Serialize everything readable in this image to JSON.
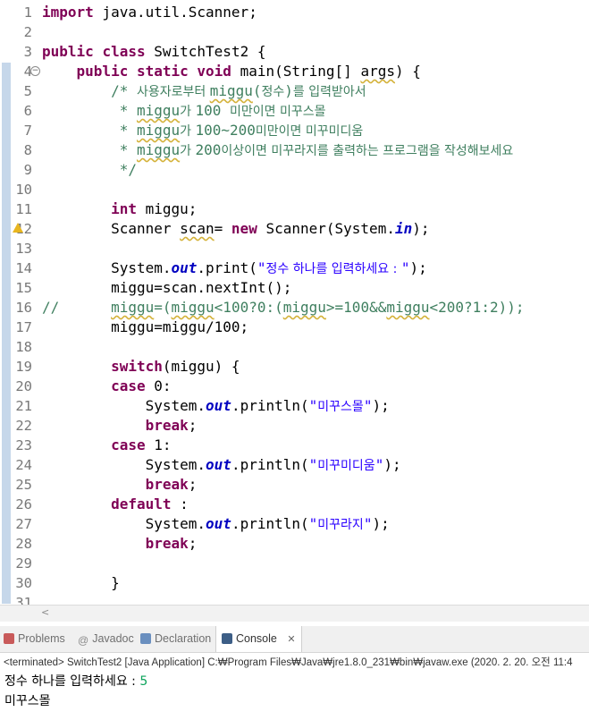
{
  "editor": {
    "lines": [
      {
        "n": "1",
        "parts": [
          {
            "t": "import",
            "c": "kw"
          },
          {
            "t": " java.util.Scanner;"
          }
        ]
      },
      {
        "n": "2",
        "parts": []
      },
      {
        "n": "3",
        "parts": [
          {
            "t": "public",
            "c": "kw"
          },
          {
            "t": " "
          },
          {
            "t": "class",
            "c": "kw"
          },
          {
            "t": " SwitchTest2 {"
          }
        ]
      },
      {
        "n": "4",
        "fold": true,
        "parts": [
          {
            "t": "    "
          },
          {
            "t": "public",
            "c": "kw"
          },
          {
            "t": " "
          },
          {
            "t": "static",
            "c": "kw"
          },
          {
            "t": " "
          },
          {
            "t": "void",
            "c": "kw"
          },
          {
            "t": " main(String[] "
          },
          {
            "t": "args",
            "c": "warn"
          },
          {
            "t": ") {"
          }
        ]
      },
      {
        "n": "5",
        "parts": [
          {
            "t": "        "
          },
          {
            "t": "/* ",
            "c": "cmt"
          },
          {
            "t": "사용자로부터 ",
            "c": "cmt kor"
          },
          {
            "t": "miggu",
            "c": "cmt warn"
          },
          {
            "t": "(",
            "c": "cmt"
          },
          {
            "t": "정수",
            "c": "cmt kor"
          },
          {
            "t": ")",
            "c": "cmt"
          },
          {
            "t": "를 입력받아서",
            "c": "cmt kor"
          }
        ]
      },
      {
        "n": "6",
        "parts": [
          {
            "t": "         * ",
            "c": "cmt"
          },
          {
            "t": "miggu",
            "c": "cmt warn"
          },
          {
            "t": "가 ",
            "c": "cmt kor"
          },
          {
            "t": "100 ",
            "c": "cmt"
          },
          {
            "t": "미만이면 미꾸스몰",
            "c": "cmt kor"
          }
        ]
      },
      {
        "n": "7",
        "parts": [
          {
            "t": "         * ",
            "c": "cmt"
          },
          {
            "t": "miggu",
            "c": "cmt warn"
          },
          {
            "t": "가 ",
            "c": "cmt kor"
          },
          {
            "t": "100~200",
            "c": "cmt"
          },
          {
            "t": "미만이면 미꾸미디움",
            "c": "cmt kor"
          }
        ]
      },
      {
        "n": "8",
        "parts": [
          {
            "t": "         * ",
            "c": "cmt"
          },
          {
            "t": "miggu",
            "c": "cmt warn"
          },
          {
            "t": "가 ",
            "c": "cmt kor"
          },
          {
            "t": "200",
            "c": "cmt"
          },
          {
            "t": "이상이면 미꾸라지를 출력하는 프로그램을 작성해보세요",
            "c": "cmt kor"
          }
        ]
      },
      {
        "n": "9",
        "parts": [
          {
            "t": "         */",
            "c": "cmt"
          }
        ]
      },
      {
        "n": "10",
        "parts": []
      },
      {
        "n": "11",
        "parts": [
          {
            "t": "        "
          },
          {
            "t": "int",
            "c": "kw"
          },
          {
            "t": " miggu;"
          }
        ]
      },
      {
        "n": "12",
        "warn": true,
        "parts": [
          {
            "t": "        Scanner "
          },
          {
            "t": "scan",
            "c": "warn"
          },
          {
            "t": "= "
          },
          {
            "t": "new",
            "c": "kw"
          },
          {
            "t": " Scanner(System."
          },
          {
            "t": "in",
            "c": "sf"
          },
          {
            "t": ");"
          }
        ]
      },
      {
        "n": "13",
        "parts": []
      },
      {
        "n": "14",
        "parts": [
          {
            "t": "        System."
          },
          {
            "t": "out",
            "c": "sf"
          },
          {
            "t": ".print("
          },
          {
            "t": "\"",
            "c": "str"
          },
          {
            "t": "정수 하나를 입력하세요 : ",
            "c": "str kor"
          },
          {
            "t": "\"",
            "c": "str"
          },
          {
            "t": ");"
          }
        ]
      },
      {
        "n": "15",
        "parts": [
          {
            "t": "        miggu=scan.nextInt();"
          }
        ]
      },
      {
        "n": "16",
        "parts": [
          {
            "t": "//      ",
            "c": "cmt"
          },
          {
            "t": "miggu",
            "c": "cmt warn"
          },
          {
            "t": "=(",
            "c": "cmt"
          },
          {
            "t": "miggu",
            "c": "cmt warn"
          },
          {
            "t": "<100?0:(",
            "c": "cmt"
          },
          {
            "t": "miggu",
            "c": "cmt warn"
          },
          {
            "t": ">=100&&",
            "c": "cmt"
          },
          {
            "t": "miggu",
            "c": "cmt warn"
          },
          {
            "t": "<200?1:2));",
            "c": "cmt"
          }
        ]
      },
      {
        "n": "17",
        "parts": [
          {
            "t": "        miggu=miggu/100;"
          }
        ]
      },
      {
        "n": "18",
        "parts": []
      },
      {
        "n": "19",
        "parts": [
          {
            "t": "        "
          },
          {
            "t": "switch",
            "c": "kw"
          },
          {
            "t": "(miggu) {"
          }
        ]
      },
      {
        "n": "20",
        "parts": [
          {
            "t": "        "
          },
          {
            "t": "case",
            "c": "kw"
          },
          {
            "t": " 0:"
          }
        ]
      },
      {
        "n": "21",
        "parts": [
          {
            "t": "            System."
          },
          {
            "t": "out",
            "c": "sf"
          },
          {
            "t": ".println("
          },
          {
            "t": "\"",
            "c": "str"
          },
          {
            "t": "미꾸스몰",
            "c": "str kor"
          },
          {
            "t": "\"",
            "c": "str"
          },
          {
            "t": ");"
          }
        ]
      },
      {
        "n": "22",
        "parts": [
          {
            "t": "            "
          },
          {
            "t": "break",
            "c": "kw"
          },
          {
            "t": ";"
          }
        ]
      },
      {
        "n": "23",
        "parts": [
          {
            "t": "        "
          },
          {
            "t": "case",
            "c": "kw"
          },
          {
            "t": " 1:"
          }
        ]
      },
      {
        "n": "24",
        "parts": [
          {
            "t": "            System."
          },
          {
            "t": "out",
            "c": "sf"
          },
          {
            "t": ".println("
          },
          {
            "t": "\"",
            "c": "str"
          },
          {
            "t": "미꾸미디움",
            "c": "str kor"
          },
          {
            "t": "\"",
            "c": "str"
          },
          {
            "t": ");"
          }
        ]
      },
      {
        "n": "25",
        "parts": [
          {
            "t": "            "
          },
          {
            "t": "break",
            "c": "kw"
          },
          {
            "t": ";"
          }
        ]
      },
      {
        "n": "26",
        "parts": [
          {
            "t": "        "
          },
          {
            "t": "default",
            "c": "kw"
          },
          {
            "t": " :"
          }
        ]
      },
      {
        "n": "27",
        "parts": [
          {
            "t": "            System."
          },
          {
            "t": "out",
            "c": "sf"
          },
          {
            "t": ".println("
          },
          {
            "t": "\"",
            "c": "str"
          },
          {
            "t": "미꾸라지",
            "c": "str kor"
          },
          {
            "t": "\"",
            "c": "str"
          },
          {
            "t": ");"
          }
        ]
      },
      {
        "n": "28",
        "parts": [
          {
            "t": "            "
          },
          {
            "t": "break",
            "c": "kw"
          },
          {
            "t": ";"
          }
        ]
      },
      {
        "n": "29",
        "parts": []
      },
      {
        "n": "30",
        "parts": [
          {
            "t": "        }"
          }
        ]
      },
      {
        "n": "31",
        "parts": []
      }
    ]
  },
  "scrollbar": {
    "left_arrow": "<"
  },
  "tabs": [
    {
      "label": "Problems",
      "icon": "problems-icon",
      "icon_color": "#c85a5a",
      "active": false
    },
    {
      "label": "Javadoc",
      "icon": "javadoc-icon",
      "icon_color": "#9a9a9a",
      "active": false
    },
    {
      "label": "Declaration",
      "icon": "declaration-icon",
      "icon_color": "#6a8fbf",
      "active": false
    },
    {
      "label": "Console",
      "icon": "console-icon",
      "icon_color": "#3d5e86",
      "active": true,
      "close": "✕"
    }
  ],
  "console": {
    "status": "<terminated> SwitchTest2 [Java Application] C:₩Program Files₩Java₩jre1.8.0_231₩bin₩javaw.exe (2020. 2. 20. 오전 11:4",
    "prompt": "정수 하나를 입력하세요 : ",
    "input": "5",
    "output": "미꾸스몰"
  },
  "colors": {
    "keyword": "#7f0055",
    "string": "#2a00ff",
    "comment": "#3f7f5f",
    "static_field": "#0000c0"
  }
}
